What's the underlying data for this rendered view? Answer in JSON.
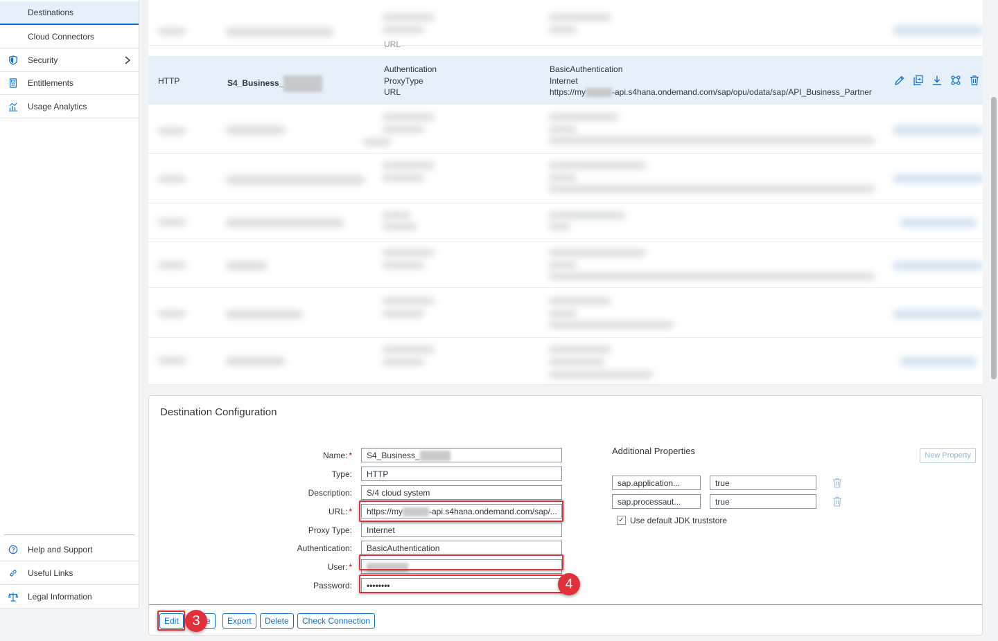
{
  "sidebar": {
    "items": [
      {
        "label": "Destinations"
      },
      {
        "label": "Cloud Connectors"
      },
      {
        "label": "Security"
      },
      {
        "label": "Entitlements"
      },
      {
        "label": "Usage Analytics"
      }
    ],
    "bottom_items": [
      {
        "label": "Help and Support"
      },
      {
        "label": "Useful Links"
      },
      {
        "label": "Legal Information"
      }
    ]
  },
  "table": {
    "selected_row": {
      "type": "HTTP",
      "name": "S4_Business_",
      "prop_keys": [
        "Authentication",
        "ProxyType",
        "URL"
      ],
      "prop_values": [
        "BasicAuthentication",
        "Internet"
      ],
      "url_prefix": "https://my",
      "url_suffix": "-api.s4hana.ondemand.com/sap/opu/odata/sap/API_Business_Partner"
    },
    "top_row_partial": {
      "key": "URL"
    }
  },
  "config": {
    "title": "Destination Configuration",
    "fields": {
      "name": {
        "label": "Name:",
        "value": "S4_Business_"
      },
      "type": {
        "label": "Type:",
        "value": "HTTP"
      },
      "description": {
        "label": "Description:",
        "value": "S/4 cloud system"
      },
      "url": {
        "label": "URL:",
        "value_prefix": "https://my",
        "value_suffix": "-api.s4hana.ondemand.com/sap/..."
      },
      "proxy_type": {
        "label": "Proxy Type:",
        "value": "Internet"
      },
      "authentication": {
        "label": "Authentication:",
        "value": "BasicAuthentication"
      },
      "user": {
        "label": "User:"
      },
      "password": {
        "label": "Password:",
        "value": "••••••••"
      }
    },
    "additional_properties": {
      "title": "Additional Properties",
      "new_property_label": "New Property",
      "properties": [
        {
          "key": "sap.application...",
          "value": "true"
        },
        {
          "key": "sap.processaut...",
          "value": "true"
        }
      ],
      "use_default_jdk_label": "Use default JDK truststore",
      "use_default_jdk": true
    },
    "buttons": {
      "edit": "Edit",
      "clone_partial": "e",
      "export": "Export",
      "delete": "Delete",
      "check_connection": "Check Connection"
    },
    "step_badges": [
      "3",
      "4"
    ],
    "accent_color": "#0a6ed1",
    "highlight_color": "#e0303a"
  }
}
